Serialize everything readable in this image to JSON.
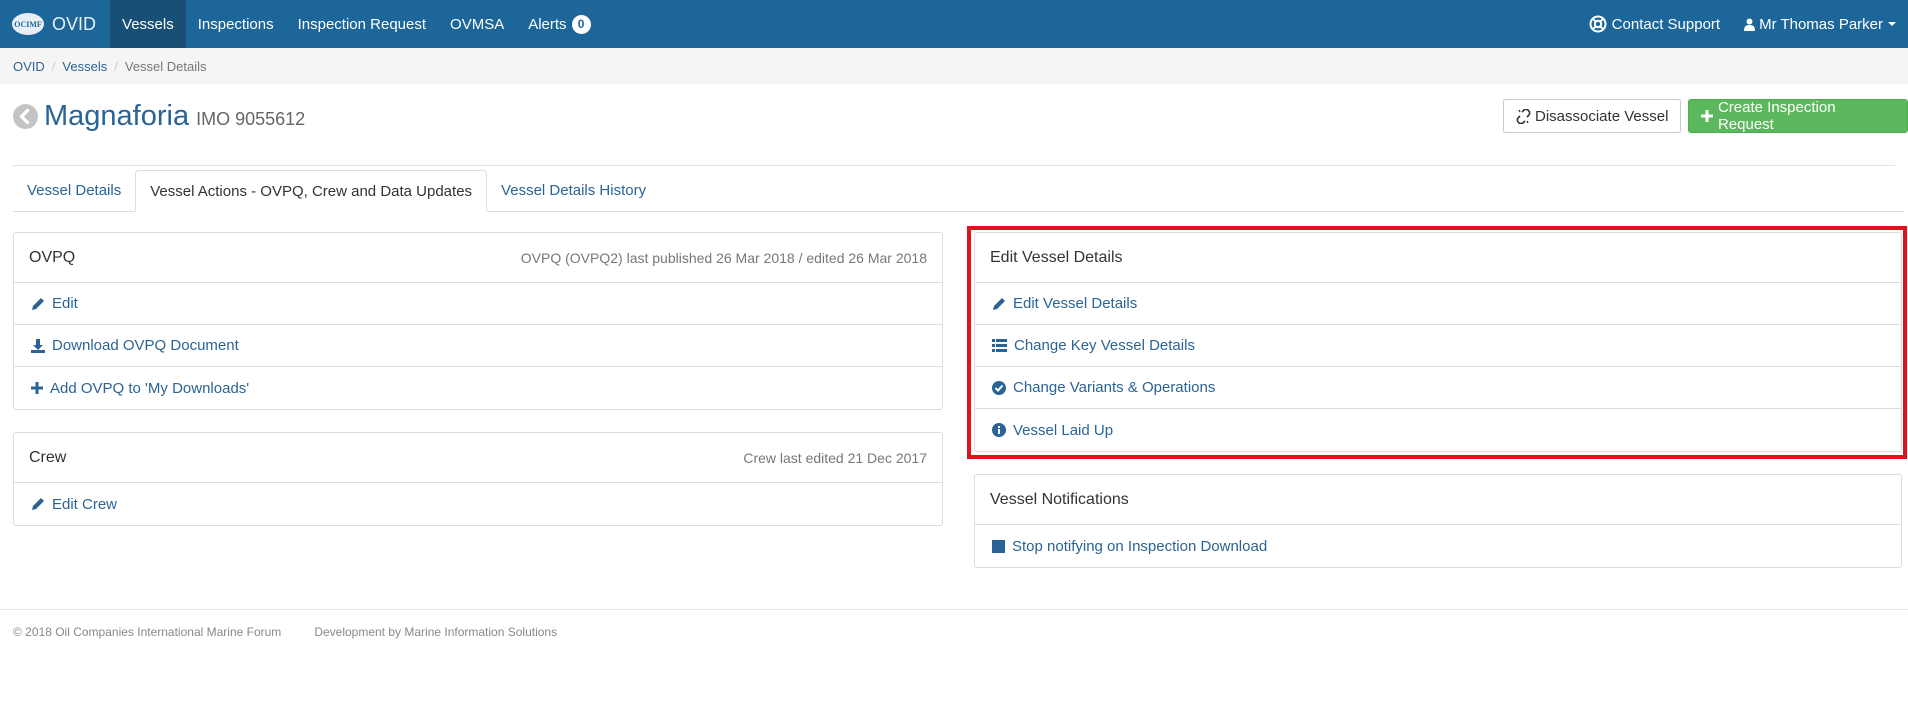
{
  "navbar": {
    "logo_text": "OCIMF",
    "brand": "OVID",
    "items": [
      {
        "label": "Vessels",
        "active": true
      },
      {
        "label": "Inspections",
        "active": false
      },
      {
        "label": "Inspection Request",
        "active": false
      },
      {
        "label": "OVMSA",
        "active": false
      },
      {
        "label": "Alerts",
        "active": false
      }
    ],
    "alerts_count": "0",
    "contact_support": "Contact Support",
    "user_name": "Mr Thomas Parker"
  },
  "breadcrumb": [
    "OVID",
    "Vessels",
    "Vessel Details"
  ],
  "header": {
    "vessel_name": "Magnaforia",
    "imo": "IMO 9055612",
    "disassociate_label": "Disassociate Vessel",
    "create_request_label": "Create Inspection Request"
  },
  "tabs": [
    {
      "label": "Vessel Details",
      "active": false
    },
    {
      "label": "Vessel Actions - OVPQ, Crew and Data Updates",
      "active": true
    },
    {
      "label": "Vessel Details History",
      "active": false
    }
  ],
  "ovpq_panel": {
    "title": "OVPQ",
    "meta": "OVPQ (OVPQ2) last published 26 Mar 2018 / edited 26 Mar 2018",
    "items": [
      "Edit",
      "Download OVPQ Document",
      "Add OVPQ to 'My Downloads'"
    ]
  },
  "crew_panel": {
    "title": "Crew",
    "meta": "Crew last edited 21 Dec 2017",
    "items": [
      "Edit Crew"
    ]
  },
  "edit_panel": {
    "title": "Edit Vessel Details",
    "items": [
      "Edit Vessel Details",
      "Change Key Vessel Details",
      "Change Variants & Operations",
      "Vessel Laid Up"
    ]
  },
  "notify_panel": {
    "title": "Vessel Notifications",
    "items": [
      "Stop notifying on Inspection Download"
    ]
  },
  "footer": {
    "copyright": "© 2018 Oil Companies International Marine Forum",
    "developer": "Development by Marine Information Solutions"
  },
  "colors": {
    "navbar": "#1d6699",
    "link": "#2a6496",
    "success": "#5cb85c",
    "highlight": "#e0111c"
  }
}
